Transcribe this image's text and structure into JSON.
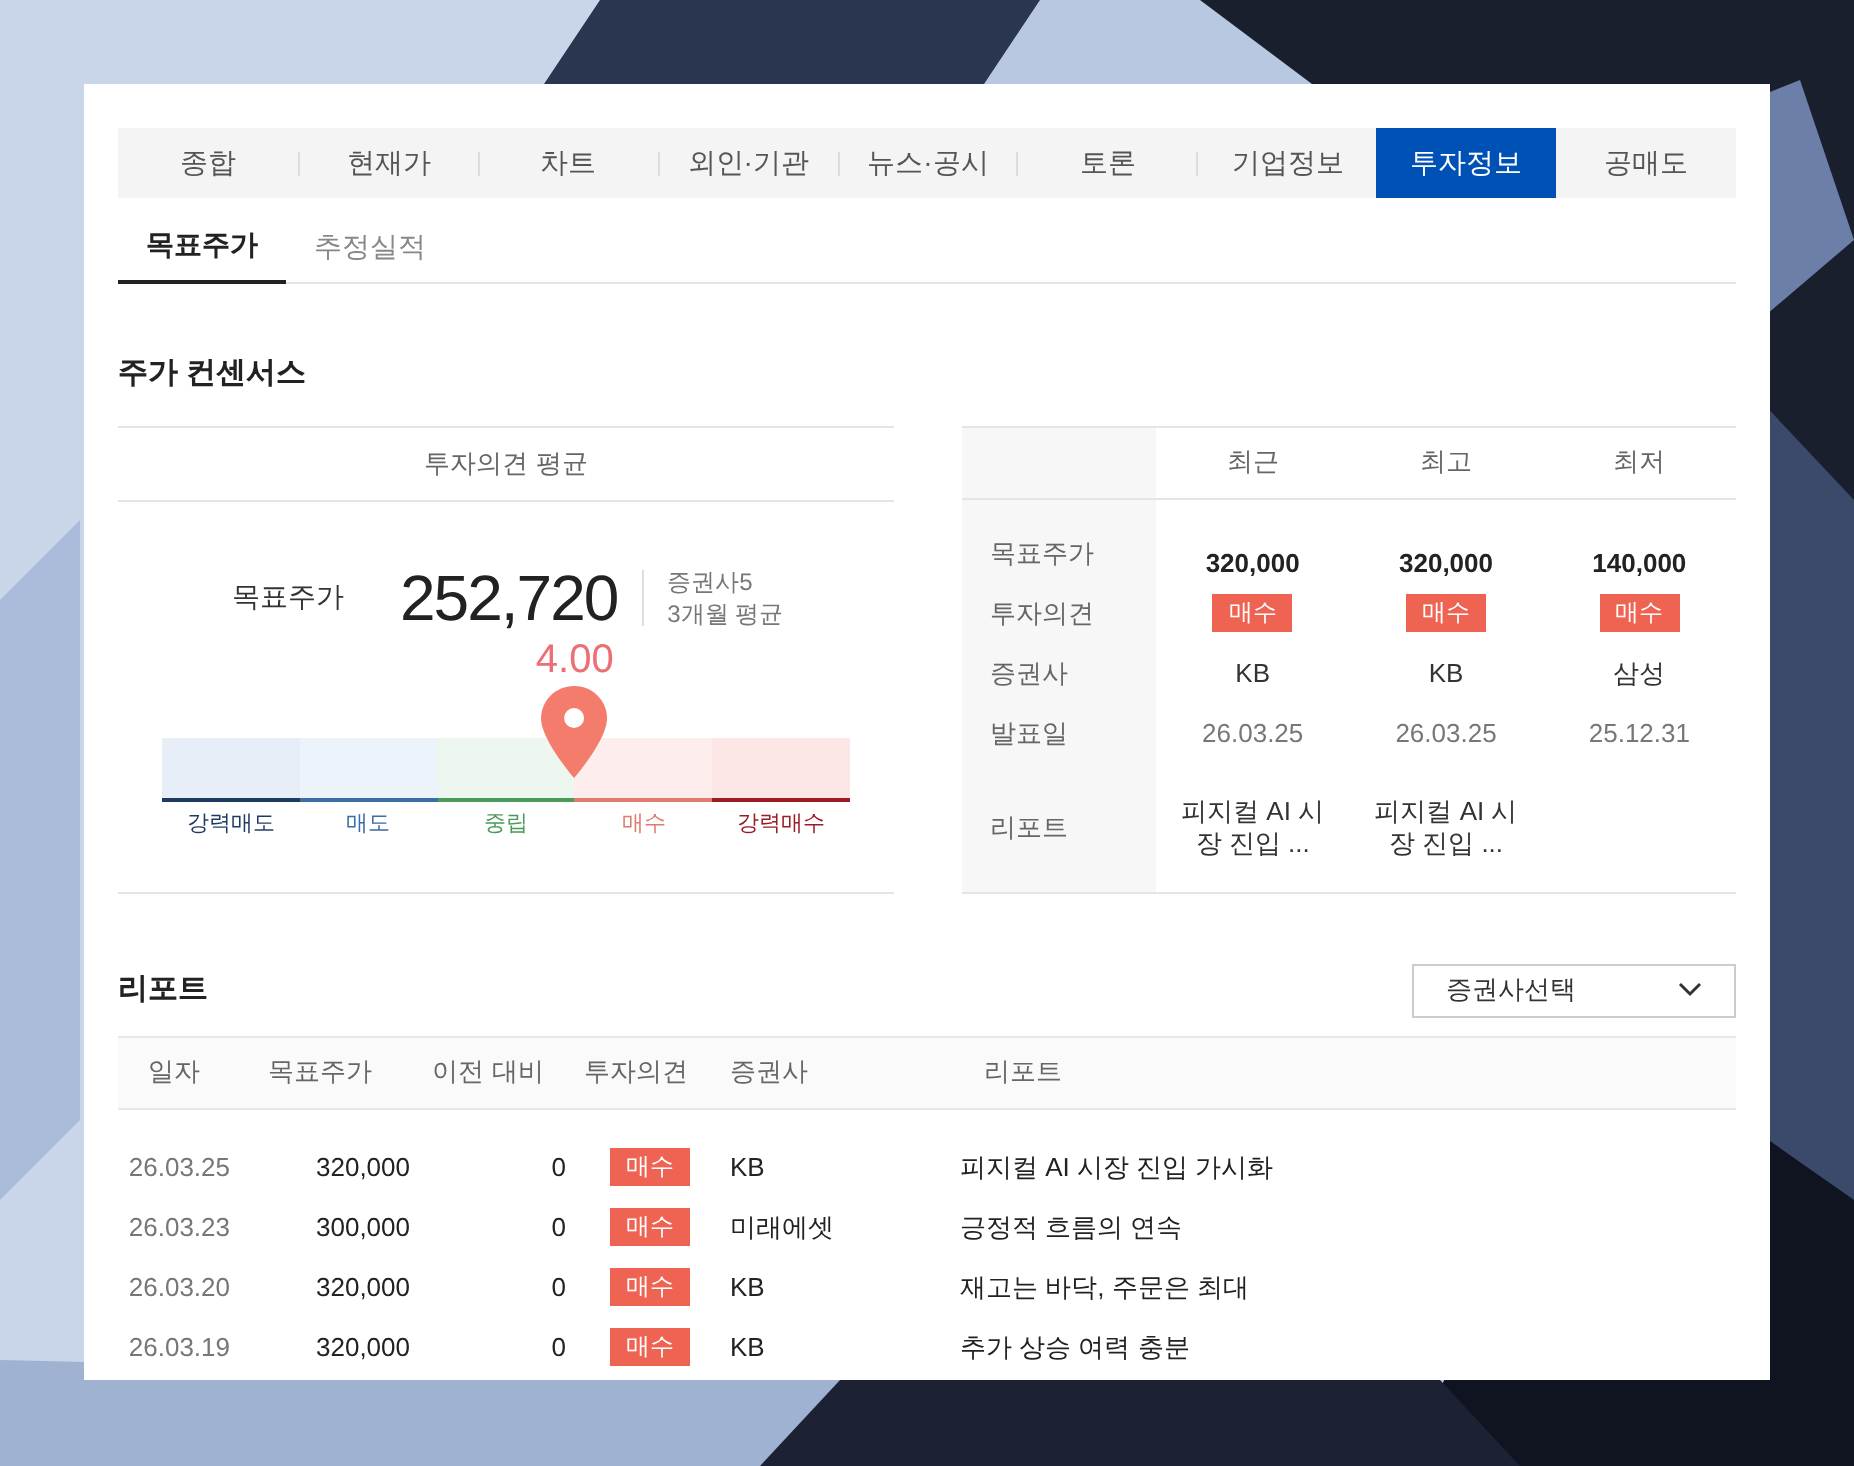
{
  "tabs": [
    {
      "label": "종합",
      "selected": false
    },
    {
      "label": "현재가",
      "selected": false
    },
    {
      "label": "차트",
      "selected": false
    },
    {
      "label": "외인·기관",
      "selected": false
    },
    {
      "label": "뉴스·공시",
      "selected": false
    },
    {
      "label": "토론",
      "selected": false
    },
    {
      "label": "기업정보",
      "selected": false
    },
    {
      "label": "투자정보",
      "selected": true
    },
    {
      "label": "공매도",
      "selected": false
    }
  ],
  "sub_tabs": [
    {
      "label": "목표주가",
      "selected": true
    },
    {
      "label": "추정실적",
      "selected": false
    }
  ],
  "consensus": {
    "title": "주가 컨센서스",
    "average": {
      "heading": "투자의견 평균",
      "label": "목표주가",
      "value": "252,720",
      "brokers": "증권사5",
      "period": "3개월 평균",
      "gauge": {
        "reading": "4.00",
        "level": 0.6,
        "segments": [
          {
            "label": "강력매도",
            "color": "#1f3a5f"
          },
          {
            "label": "매도",
            "color": "#3a6ea5"
          },
          {
            "label": "중립",
            "color": "#4a9a5a"
          },
          {
            "label": "매수",
            "color": "#e07b70"
          },
          {
            "label": "강력매수",
            "color": "#9b1c25"
          }
        ]
      }
    },
    "summary": {
      "columns": [
        "최근",
        "최고",
        "최저"
      ],
      "rows": [
        {
          "label": "목표주가",
          "kind": "price",
          "values": [
            "320,000",
            "320,000",
            "140,000"
          ]
        },
        {
          "label": "투자의견",
          "kind": "opinion",
          "values": [
            "매수",
            "매수",
            "매수"
          ]
        },
        {
          "label": "증권사",
          "kind": "text",
          "values": [
            "KB",
            "KB",
            "삼성"
          ]
        },
        {
          "label": "발표일",
          "kind": "date",
          "values": [
            "26.03.25",
            "26.03.25",
            "25.12.31"
          ]
        },
        {
          "label": "리포트",
          "kind": "report",
          "values": [
            "피지컬 AI 시장 진입 ...",
            "피지컬 AI 시장 진입 ..."
          ]
        }
      ]
    }
  },
  "reports": {
    "title": "리포트",
    "broker_select": "증권사선택",
    "columns": [
      "일자",
      "목표주가",
      "이전 대비",
      "투자의견",
      "증권사",
      "리포트"
    ],
    "rows": [
      {
        "date": "26.03.25",
        "target": "320,000",
        "change": "0",
        "opinion": "매수",
        "broker": "KB",
        "title": "피지컬 AI 시장 진입 가시화"
      },
      {
        "date": "26.03.23",
        "target": "300,000",
        "change": "0",
        "opinion": "매수",
        "broker": "미래에셋",
        "title": "긍정적 흐름의 연속"
      },
      {
        "date": "26.03.20",
        "target": "320,000",
        "change": "0",
        "opinion": "매수",
        "broker": "KB",
        "title": "재고는 바닥, 주문은 최대"
      },
      {
        "date": "26.03.19",
        "target": "320,000",
        "change": "0",
        "opinion": "매수",
        "broker": "KB",
        "title": "추가 상승 여력 충분"
      }
    ]
  }
}
